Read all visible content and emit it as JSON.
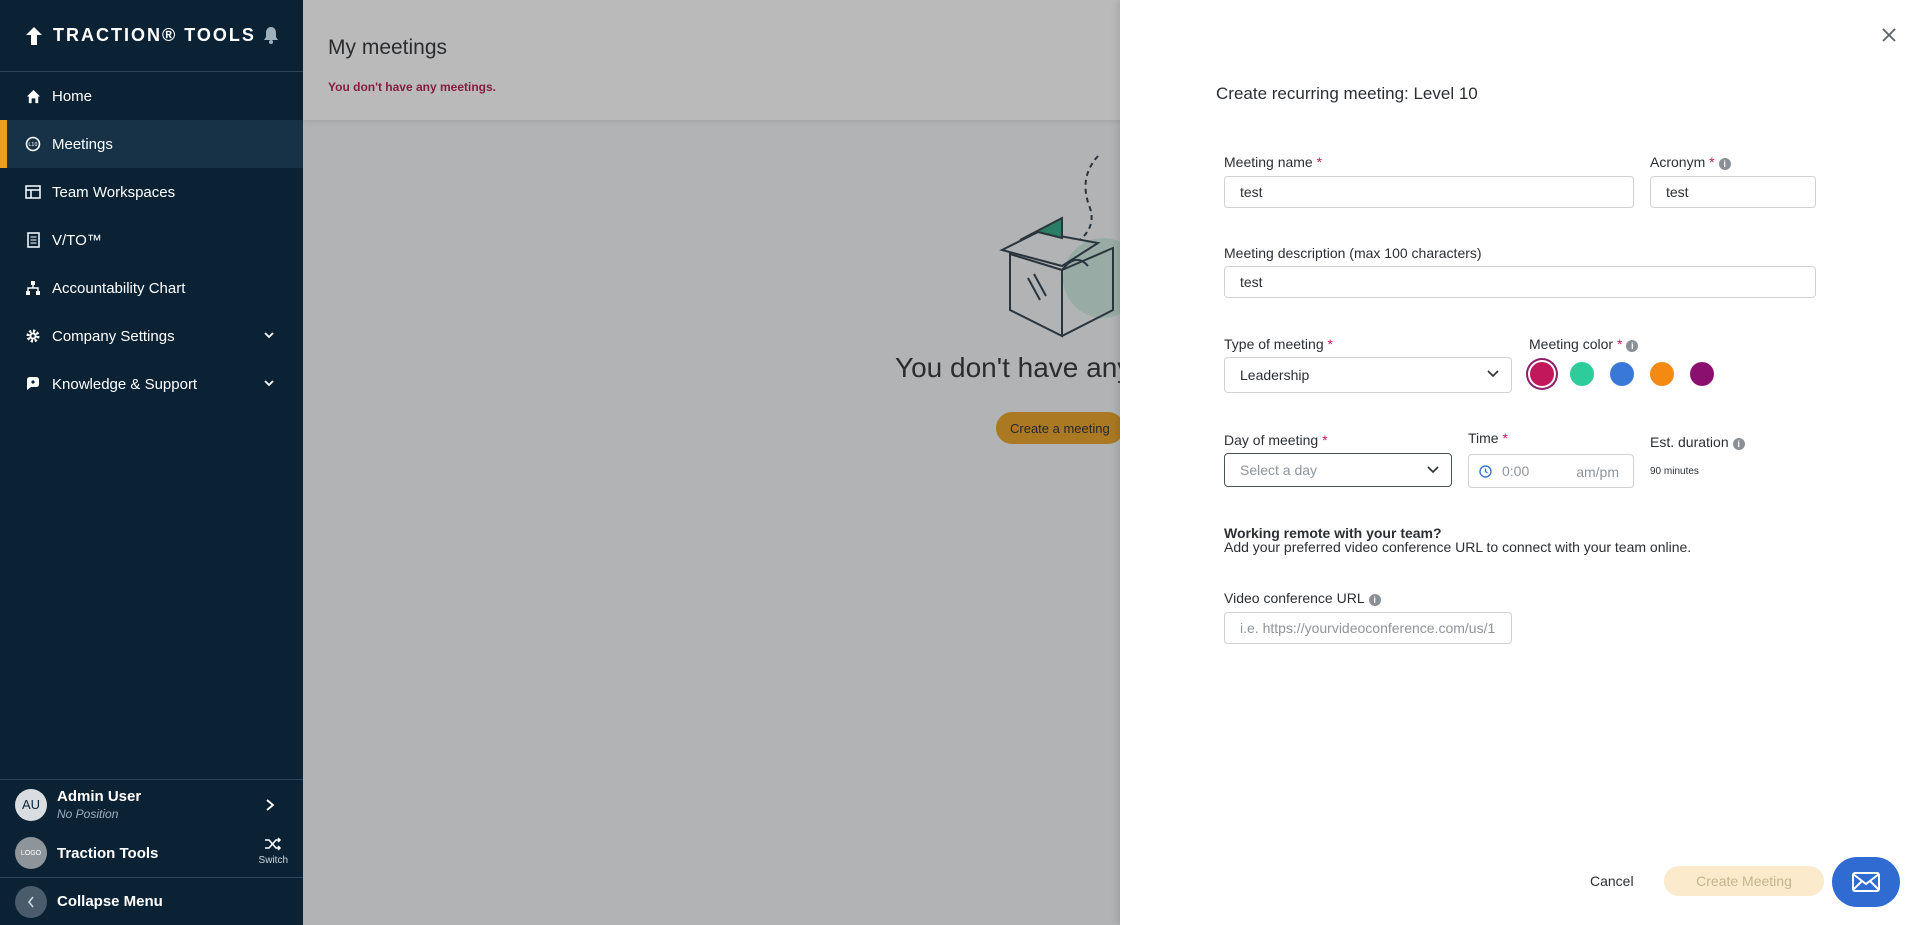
{
  "brand": {
    "name": "TRACTION® TOOLS"
  },
  "sidebar": {
    "items": [
      {
        "label": "Home",
        "icon": "home-icon"
      },
      {
        "label": "Meetings",
        "icon": "meetings-icon",
        "active": true
      },
      {
        "label": "Team Workspaces",
        "icon": "workspace-icon"
      },
      {
        "label": "V/TO™",
        "icon": "document-icon"
      },
      {
        "label": "Accountability Chart",
        "icon": "org-chart-icon"
      },
      {
        "label": "Company Settings",
        "icon": "gear-icon",
        "expandable": true
      },
      {
        "label": "Knowledge & Support",
        "icon": "support-icon",
        "expandable": true
      }
    ],
    "user": {
      "initials": "AU",
      "name": "Admin User",
      "position": "No Position"
    },
    "org": {
      "logo_text": "LOGO",
      "name": "Traction Tools",
      "switch_label": "Switch"
    },
    "collapse_label": "Collapse Menu"
  },
  "main": {
    "title": "My meetings",
    "note": "You don't have any meetings.",
    "empty_title": "You don't have any meetings",
    "create_button": "Create a meeting"
  },
  "drawer": {
    "title": "Create recurring meeting: Level 10",
    "meeting_name": {
      "label": "Meeting name",
      "value": "test"
    },
    "acronym": {
      "label": "Acronym",
      "value": "test"
    },
    "description": {
      "label": "Meeting description (max 100 characters)",
      "value": "test"
    },
    "type": {
      "label": "Type of meeting",
      "value": "Leadership"
    },
    "color": {
      "label": "Meeting color",
      "options": [
        "#c2185b",
        "#2ecc9a",
        "#3a78d8",
        "#f48a12",
        "#8a0f6e"
      ],
      "selected": "#c2185b"
    },
    "day": {
      "label": "Day of meeting",
      "placeholder": "Select a day"
    },
    "time": {
      "label": "Time",
      "placeholder": "0:00",
      "ampm": "am/pm"
    },
    "duration": {
      "label": "Est. duration",
      "value": "90 minutes"
    },
    "remote": {
      "title": "Working remote with your team?",
      "description": "Add your preferred video conference URL to connect with your team online."
    },
    "video_url": {
      "label": "Video conference URL",
      "placeholder": "i.e. https://yourvideoconference.com/us/1"
    },
    "cancel_label": "Cancel",
    "create_label": "Create Meeting"
  },
  "colors": {
    "sidebar_bg": "#0b2235",
    "accent": "#e8a020",
    "required": "#c2185b",
    "chat": "#2f6bd1"
  }
}
